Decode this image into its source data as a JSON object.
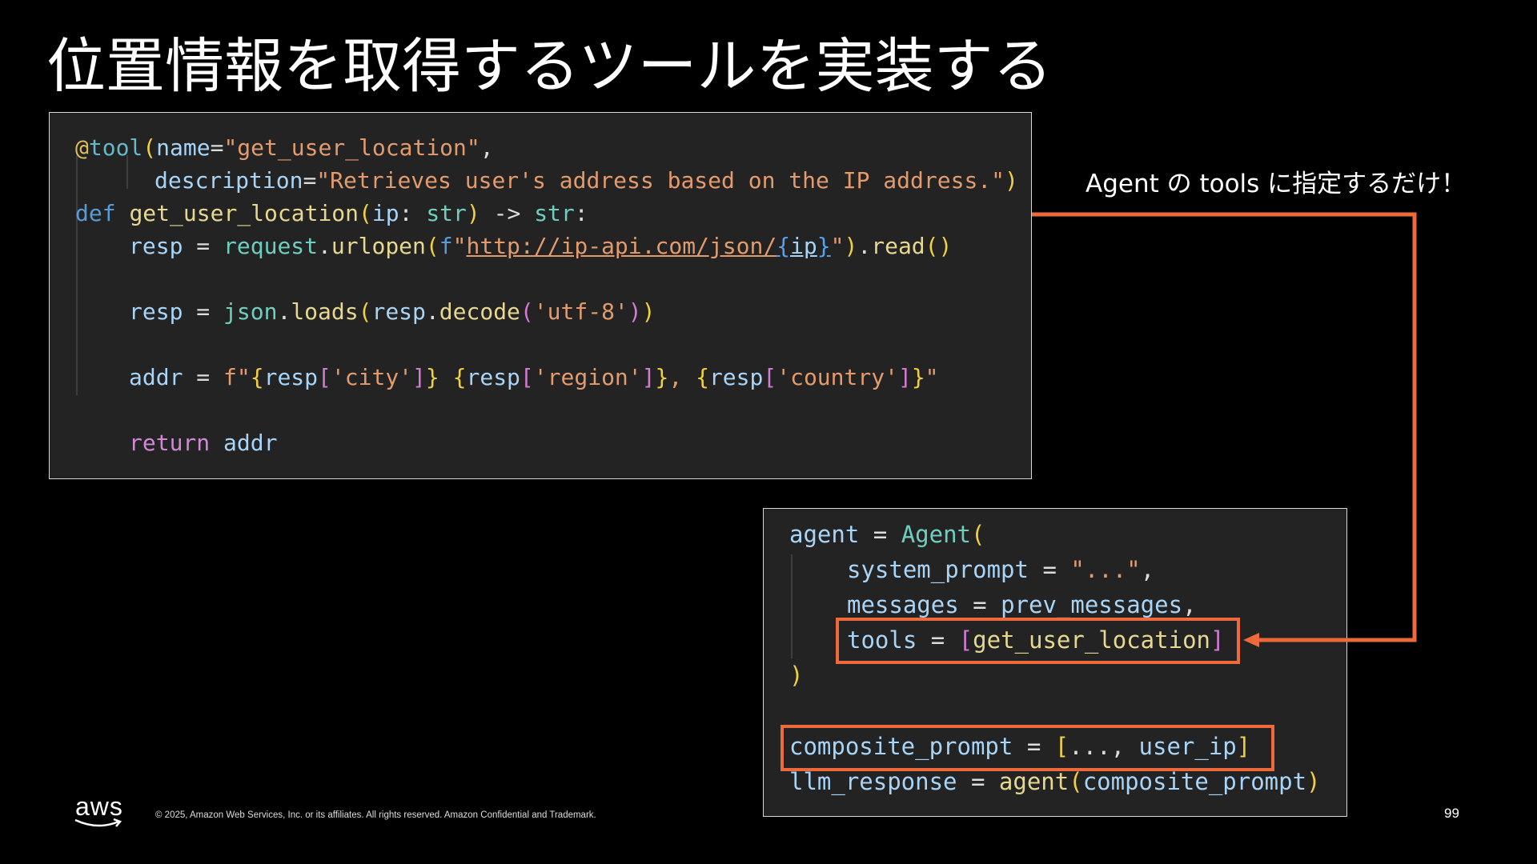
{
  "slide": {
    "title": "位置情報を取得するツールを実装する",
    "note": "Agent の tools に指定するだけ！",
    "page_number": "99",
    "copyright": "© 2025, Amazon Web Services, Inc. or its affiliates. All rights reserved. Amazon Confidential and Trademark.",
    "logo_text": "aws"
  },
  "code_tool": {
    "l1": {
      "at": "@",
      "dec": "tool",
      "open": "(",
      "p": "name",
      "eq": "=",
      "s": "\"get_user_location\"",
      "c": ","
    },
    "l2": {
      "p": "description",
      "eq": "=",
      "s": "\"Retrieves user's address based on the IP address.\"",
      "close": ")"
    },
    "l3": {
      "def": "def",
      "sp": " ",
      "fn": "get_user_location",
      "open": "(",
      "p": "ip",
      "colon": ": ",
      "ty": "str",
      "close": ")",
      "arrow": " -> ",
      "rty": "str",
      "end": ":"
    },
    "l4": {
      "v": "resp",
      "eq": " = ",
      "mod": "request",
      "dot": ".",
      "fn": "urlopen",
      "open": "(",
      "f": "f",
      "q": "\"",
      "url": "http://ip-api.com/json/",
      "br1": "{",
      "uv": "ip",
      "br2": "}",
      "q2": "\"",
      "close": ")",
      "dot2": ".",
      "fn2": "read",
      "par": "()"
    },
    "l5": {
      "v": "resp",
      "eq": " = ",
      "mod": "json",
      "dot": ".",
      "fn": "loads",
      "open": "(",
      "a": "resp",
      "dot2": ".",
      "m": "decode",
      "open2": "(",
      "s": "'utf-8'",
      "close2": ")",
      "close": ")"
    },
    "l6": {
      "v": "addr",
      "eq": " = ",
      "f": "f\"",
      "b1": "{",
      "r1": "resp",
      "k1o": "[",
      "k1": "'city'",
      "k1c": "]",
      "b1c": "}",
      "sp": " ",
      "b2": "{",
      "r2": "resp",
      "k2o": "[",
      "k2": "'region'",
      "k2c": "]",
      "b2c": "}",
      "cm": ", ",
      "b3": "{",
      "r3": "resp",
      "k3o": "[",
      "k3": "'country'",
      "k3c": "]",
      "b3c": "}",
      "qe": "\""
    },
    "l7": {
      "ret": "return",
      "sp": " ",
      "v": "addr"
    }
  },
  "code_agent": {
    "l1": {
      "v": "agent",
      "eq": " = ",
      "cls": "Agent",
      "open": "("
    },
    "l2": {
      "p": "system_prompt",
      "eq": " = ",
      "s": "\"...\"",
      "c": ","
    },
    "l3": {
      "p": "messages",
      "eq": " = ",
      "v": "prev_messages",
      "c": ","
    },
    "l4": {
      "p": "tools",
      "eq": " = ",
      "open": "[",
      "v": "get_user_location",
      "close": "]"
    },
    "l5": {
      "close": ")"
    },
    "l6": {
      "v": "composite_prompt",
      "eq": " = ",
      "open": "[",
      "dots": "..., ",
      "v2": "user_ip",
      "close": "]"
    },
    "l7": {
      "v": "llm_response",
      "eq": " = ",
      "fn": "agent",
      "open": "(",
      "a": "composite_prompt",
      "close": ")"
    }
  },
  "colors": {
    "highlight": "#ef6a3a",
    "background": "#000000",
    "code_bg": "#232323"
  }
}
